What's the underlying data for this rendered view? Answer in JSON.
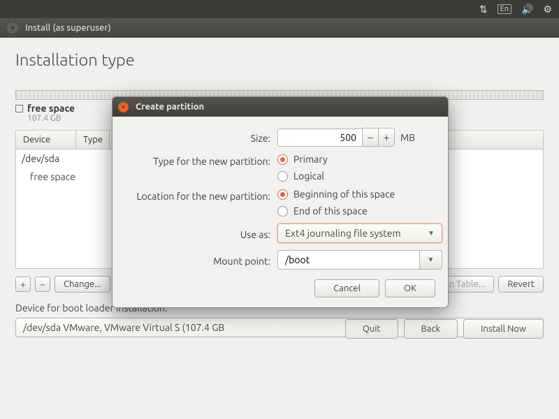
{
  "menubar": {
    "icons": [
      "updown",
      "lang",
      "volume",
      "gear"
    ],
    "lang_label": "En"
  },
  "window": {
    "title": "Install (as superuser)"
  },
  "page": {
    "heading": "Installation type"
  },
  "partition_overview": {
    "free_space_name": "free space",
    "free_space_size": "107.4 GB"
  },
  "device_table": {
    "columns": {
      "device": "Device",
      "type": "Type"
    },
    "rows": [
      {
        "label": "/dev/sda",
        "indent": false
      },
      {
        "label": "free space",
        "indent": true
      }
    ]
  },
  "table_actions": {
    "add": "+",
    "remove": "−",
    "change": "Change...",
    "new_table": "New Partition Table...",
    "revert": "Revert"
  },
  "bootloader": {
    "label": "Device for boot loader installation:",
    "value": "/dev/sda   VMware, VMware Virtual S (107.4 GB"
  },
  "footer": {
    "quit": "Quit",
    "back": "Back",
    "install": "Install Now"
  },
  "dialog": {
    "title": "Create partition",
    "size_label": "Size:",
    "size_value": "500",
    "size_unit": "MB",
    "type_label": "Type for the new partition:",
    "type_options": {
      "primary": "Primary",
      "logical": "Logical"
    },
    "type_selected": "primary",
    "location_label": "Location for the new partition:",
    "location_options": {
      "beginning": "Beginning of this space",
      "end": "End of this space"
    },
    "location_selected": "beginning",
    "use_as_label": "Use as:",
    "use_as_value": "Ext4 journaling file system",
    "mount_label": "Mount point:",
    "mount_value": "/boot",
    "cancel": "Cancel",
    "ok": "OK"
  }
}
